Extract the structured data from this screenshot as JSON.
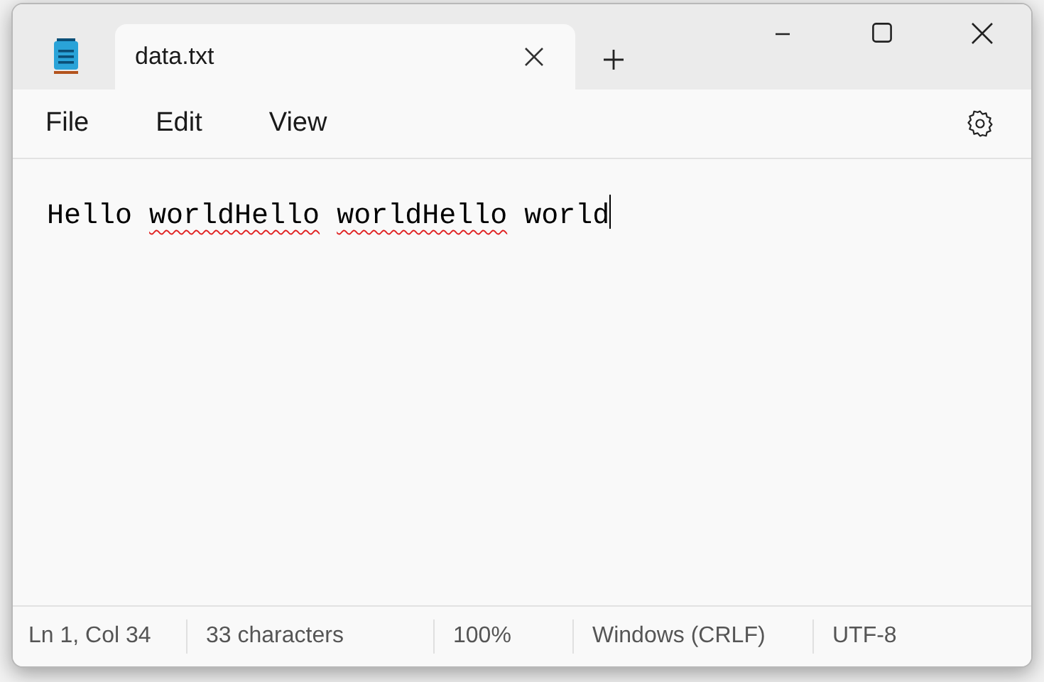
{
  "tabs": [
    {
      "label": "data.txt",
      "selected": true
    }
  ],
  "menu": [
    "File",
    "Edit",
    "View"
  ],
  "editor": {
    "words": [
      {
        "text": "Hello",
        "misspelled": false
      },
      {
        "text": "worldHello",
        "misspelled": true
      },
      {
        "text": "worldHello",
        "misspelled": true
      },
      {
        "text": "world",
        "misspelled": false
      }
    ],
    "caret": true
  },
  "status_bar": [
    "Ln 1, Col 34",
    "33 characters",
    "100%",
    "Windows (CRLF)",
    "UTF-8"
  ]
}
